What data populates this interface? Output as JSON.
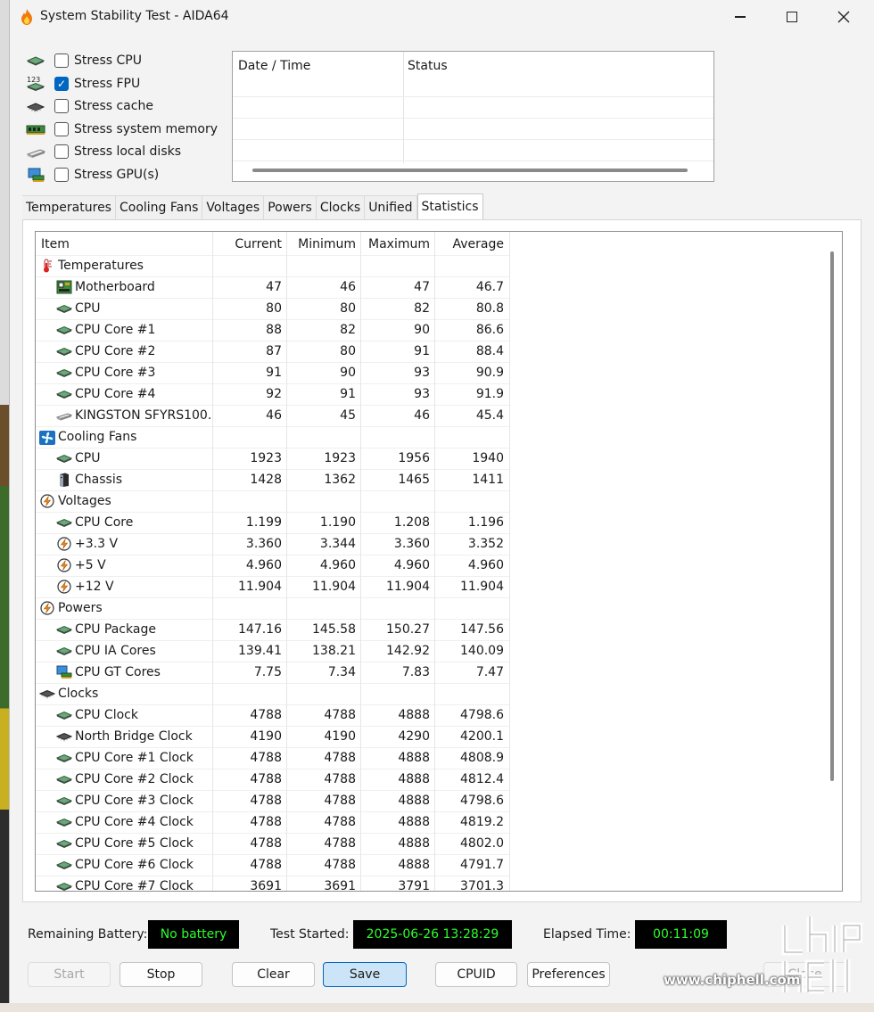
{
  "window": {
    "title": "System Stability Test - AIDA64"
  },
  "stress": [
    {
      "label": "Stress CPU",
      "checked": false,
      "icon": "cpu-chip-icon"
    },
    {
      "label": "Stress FPU",
      "checked": true,
      "icon": "fpu-123-icon"
    },
    {
      "label": "Stress cache",
      "checked": false,
      "icon": "cache-chip-icon"
    },
    {
      "label": "Stress system memory",
      "checked": false,
      "icon": "memory-module-icon"
    },
    {
      "label": "Stress local disks",
      "checked": false,
      "icon": "disk-drive-icon"
    },
    {
      "label": "Stress GPU(s)",
      "checked": false,
      "icon": "gpu-monitor-icon"
    }
  ],
  "status_table": {
    "col_date": "Date / Time",
    "col_status": "Status"
  },
  "tabs": [
    "Temperatures",
    "Cooling Fans",
    "Voltages",
    "Powers",
    "Clocks",
    "Unified",
    "Statistics"
  ],
  "active_tab": "Statistics",
  "grid": {
    "headers": {
      "item": "Item",
      "current": "Current",
      "minimum": "Minimum",
      "maximum": "Maximum",
      "average": "Average"
    },
    "rows": [
      {
        "type": "group",
        "label": "Temperatures",
        "icon": "thermometer-icon"
      },
      {
        "type": "item",
        "label": "Motherboard",
        "icon": "motherboard-icon",
        "cur": "47",
        "min": "46",
        "max": "47",
        "avg": "46.7"
      },
      {
        "type": "item",
        "label": "CPU",
        "icon": "cpu-chip-icon",
        "cur": "80",
        "min": "80",
        "max": "82",
        "avg": "80.8"
      },
      {
        "type": "item",
        "label": "CPU Core #1",
        "icon": "cpu-chip-icon",
        "cur": "88",
        "min": "82",
        "max": "90",
        "avg": "86.6"
      },
      {
        "type": "item",
        "label": "CPU Core #2",
        "icon": "cpu-chip-icon",
        "cur": "87",
        "min": "80",
        "max": "91",
        "avg": "88.4"
      },
      {
        "type": "item",
        "label": "CPU Core #3",
        "icon": "cpu-chip-icon",
        "cur": "91",
        "min": "90",
        "max": "93",
        "avg": "90.9"
      },
      {
        "type": "item",
        "label": "CPU Core #4",
        "icon": "cpu-chip-icon",
        "cur": "92",
        "min": "91",
        "max": "93",
        "avg": "91.9"
      },
      {
        "type": "item",
        "label": "KINGSTON SFYRS100...",
        "icon": "disk-drive-icon",
        "cur": "46",
        "min": "45",
        "max": "46",
        "avg": "45.4"
      },
      {
        "type": "group",
        "label": "Cooling Fans",
        "icon": "fan-icon"
      },
      {
        "type": "item",
        "label": "CPU",
        "icon": "cpu-chip-icon",
        "cur": "1923",
        "min": "1923",
        "max": "1956",
        "avg": "1940"
      },
      {
        "type": "item",
        "label": "Chassis",
        "icon": "chassis-icon",
        "cur": "1428",
        "min": "1362",
        "max": "1465",
        "avg": "1411"
      },
      {
        "type": "group",
        "label": "Voltages",
        "icon": "lightning-icon"
      },
      {
        "type": "item",
        "label": "CPU Core",
        "icon": "cpu-chip-icon",
        "cur": "1.199",
        "min": "1.190",
        "max": "1.208",
        "avg": "1.196"
      },
      {
        "type": "item",
        "label": "+3.3 V",
        "icon": "lightning-icon",
        "cur": "3.360",
        "min": "3.344",
        "max": "3.360",
        "avg": "3.352"
      },
      {
        "type": "item",
        "label": "+5 V",
        "icon": "lightning-icon",
        "cur": "4.960",
        "min": "4.960",
        "max": "4.960",
        "avg": "4.960"
      },
      {
        "type": "item",
        "label": "+12 V",
        "icon": "lightning-icon",
        "cur": "11.904",
        "min": "11.904",
        "max": "11.904",
        "avg": "11.904"
      },
      {
        "type": "group",
        "label": "Powers",
        "icon": "lightning-icon"
      },
      {
        "type": "item",
        "label": "CPU Package",
        "icon": "cpu-chip-icon",
        "cur": "147.16",
        "min": "145.58",
        "max": "150.27",
        "avg": "147.56"
      },
      {
        "type": "item",
        "label": "CPU IA Cores",
        "icon": "cpu-chip-icon",
        "cur": "139.41",
        "min": "138.21",
        "max": "142.92",
        "avg": "140.09"
      },
      {
        "type": "item",
        "label": "CPU GT Cores",
        "icon": "gpu-monitor-icon",
        "cur": "7.75",
        "min": "7.34",
        "max": "7.83",
        "avg": "7.47"
      },
      {
        "type": "group",
        "label": "Clocks",
        "icon": "clock-chip-icon"
      },
      {
        "type": "item",
        "label": "CPU Clock",
        "icon": "cpu-chip-icon",
        "cur": "4788",
        "min": "4788",
        "max": "4888",
        "avg": "4798.6"
      },
      {
        "type": "item",
        "label": "North Bridge Clock",
        "icon": "clock-chip-icon",
        "cur": "4190",
        "min": "4190",
        "max": "4290",
        "avg": "4200.1"
      },
      {
        "type": "item",
        "label": "CPU Core #1 Clock",
        "icon": "cpu-chip-icon",
        "cur": "4788",
        "min": "4788",
        "max": "4888",
        "avg": "4808.9"
      },
      {
        "type": "item",
        "label": "CPU Core #2 Clock",
        "icon": "cpu-chip-icon",
        "cur": "4788",
        "min": "4788",
        "max": "4888",
        "avg": "4812.4"
      },
      {
        "type": "item",
        "label": "CPU Core #3 Clock",
        "icon": "cpu-chip-icon",
        "cur": "4788",
        "min": "4788",
        "max": "4888",
        "avg": "4798.6"
      },
      {
        "type": "item",
        "label": "CPU Core #4 Clock",
        "icon": "cpu-chip-icon",
        "cur": "4788",
        "min": "4788",
        "max": "4888",
        "avg": "4819.2"
      },
      {
        "type": "item",
        "label": "CPU Core #5 Clock",
        "icon": "cpu-chip-icon",
        "cur": "4788",
        "min": "4788",
        "max": "4888",
        "avg": "4802.0"
      },
      {
        "type": "item",
        "label": "CPU Core #6 Clock",
        "icon": "cpu-chip-icon",
        "cur": "4788",
        "min": "4788",
        "max": "4888",
        "avg": "4791.7"
      },
      {
        "type": "item",
        "label": "CPU Core #7 Clock",
        "icon": "cpu-chip-icon",
        "cur": "3691",
        "min": "3691",
        "max": "3791",
        "avg": "3701.3"
      }
    ]
  },
  "footer": {
    "battery_label": "Remaining Battery:",
    "battery_value": "No battery",
    "started_label": "Test Started:",
    "started_value": "2025-06-26 13:28:29",
    "elapsed_label": "Elapsed Time:",
    "elapsed_value": "00:11:09"
  },
  "buttons": {
    "start": "Start",
    "stop": "Stop",
    "clear": "Clear",
    "save": "Save",
    "cpuid": "CPUID",
    "preferences": "Preferences",
    "close": "Close"
  },
  "watermark": {
    "text": "www.chiphell.com"
  },
  "colors": {
    "lcd_text": "#2cff2c",
    "accent": "#0067c0",
    "save_button_bg": "#cce4f7"
  }
}
